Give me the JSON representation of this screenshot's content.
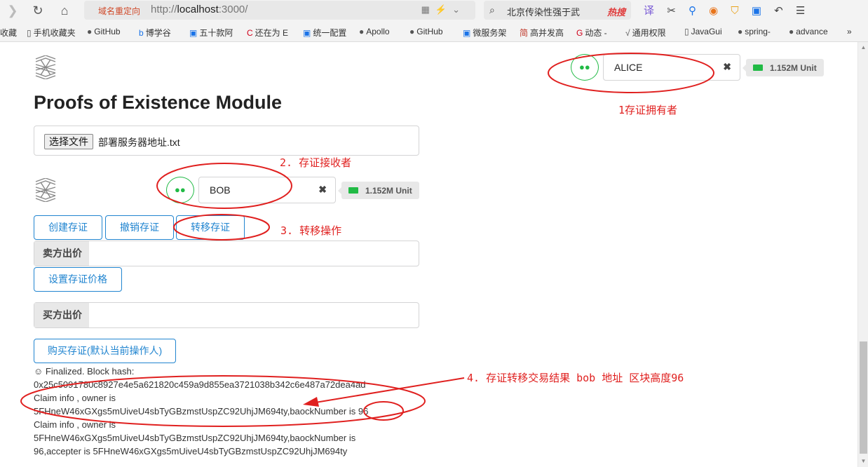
{
  "browser": {
    "address_redirect": "域名重定向",
    "address_prefix": "http://",
    "address_host": "localhost",
    "address_rest": ":3000/",
    "search_text": "北京传染性强于武",
    "search_hot": "热搜"
  },
  "bookmarks": [
    "收藏",
    "手机收藏夹",
    "GitHub",
    "博学谷",
    "五十款阿",
    "还在为 E",
    "统一配置",
    "Apollo",
    "GitHub",
    "微服务架",
    "高并发高",
    "动态 -",
    "通用权限",
    "JavaGui",
    "spring-",
    "advance"
  ],
  "page": {
    "title": "Proofs of Existence Module",
    "file_button": "选择文件",
    "file_name": "部署服务器地址.txt",
    "owner_account": {
      "name": "ALICE",
      "balance": "1.152M Unit"
    },
    "receiver_account": {
      "name": "BOB",
      "balance": "1.152M Unit"
    },
    "buttons": {
      "create": "创建存证",
      "revoke": "撤销存证",
      "transfer": "转移存证",
      "set_price": "设置存证价格",
      "buy": "购买存证(默认当前操作人)"
    },
    "seller_label": "卖方出价",
    "buyer_label": "买方出价",
    "result_lines": [
      "☺ Finalized. Block hash:",
      "0x25c5091780c8927e4e5a621820c459a9d855ea3721038b342c6e487a72dea4ad",
      "Claim info , owner is",
      "5FHneW46xGXgs5mUiveU4sbTyGBzmstUspZC92UhjJM694ty,baockNumber is 96",
      "Claim info , owner is",
      "5FHneW46xGXgs5mUiveU4sbTyGBzmstUspZC92UhjJM694ty,baockNumber is",
      "96,accepter is 5FHneW46xGXgs5mUiveU4sbTyGBzmstUspZC92UhjJM694ty"
    ]
  },
  "annotations": {
    "a1": "1存证拥有者",
    "a2": "2. 存证接收者",
    "a3": "3. 转移操作",
    "a4": "4. 存证转移交易结果 bob 地址 区块高度96"
  },
  "colors": {
    "accent_blue": "#2185d0",
    "avatar_green": "#21ba45",
    "annotation_red": "#e0201f"
  }
}
